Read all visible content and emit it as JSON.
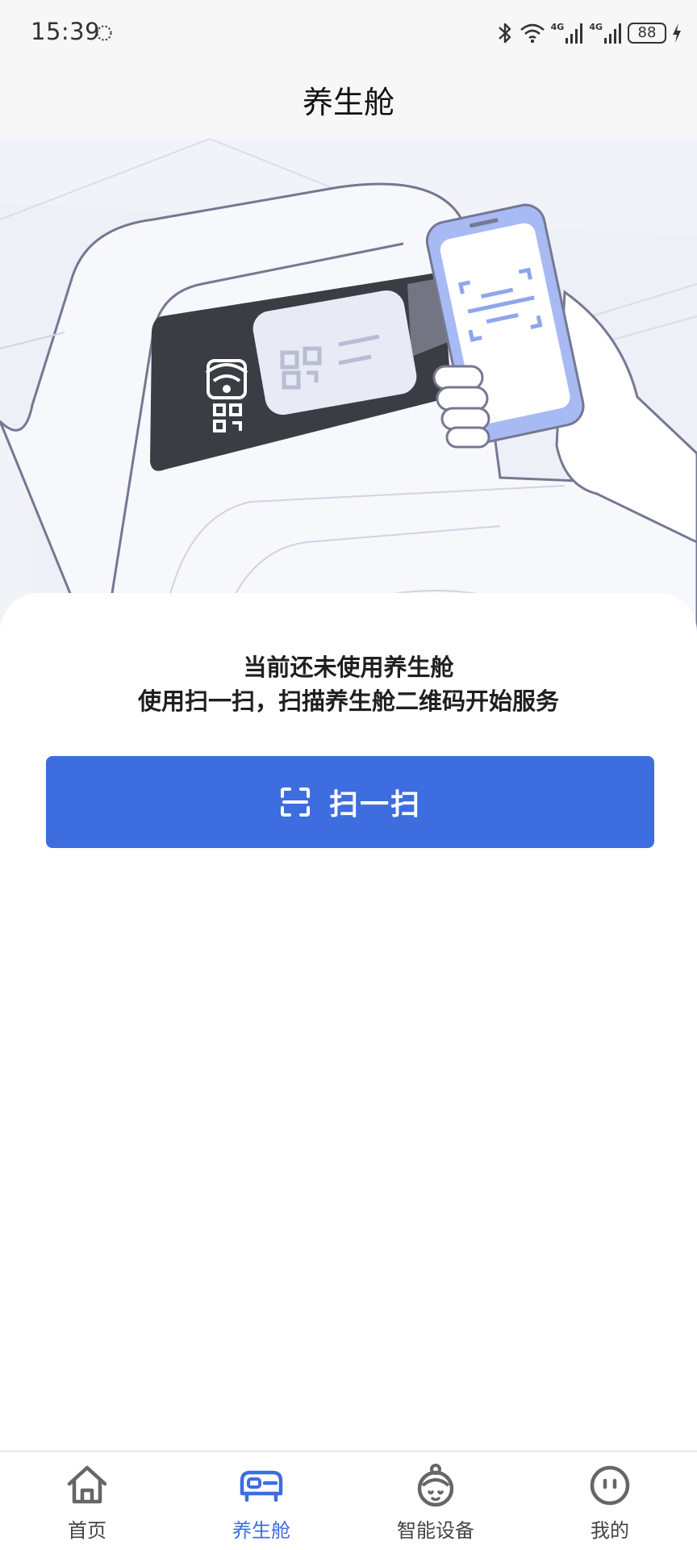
{
  "status_bar": {
    "time": "15:39",
    "net_type_1": "4G",
    "net_type_2": "4G",
    "battery": "88",
    "icons": [
      "loading-icon",
      "bluetooth-icon",
      "wifi-icon",
      "signal-icon",
      "signal-icon",
      "battery-icon",
      "charging-icon"
    ]
  },
  "nav": {
    "title": "养生舱"
  },
  "hero": {
    "icon": "scan-qr-illustration"
  },
  "message": {
    "line1": "当前还未使用养生舱",
    "line2": "使用扫一扫，扫描养生舱二维码开始服务"
  },
  "scan_button": {
    "label": "扫一扫",
    "icon": "scan-icon"
  },
  "tabs": [
    {
      "label": "首页",
      "icon": "home-icon",
      "active": false
    },
    {
      "label": "养生舱",
      "icon": "capsule-icon",
      "active": true
    },
    {
      "label": "智能设备",
      "icon": "smart-device-icon",
      "active": false
    },
    {
      "label": "我的",
      "icon": "profile-icon",
      "active": false
    }
  ],
  "colors": {
    "accent": "#3e6de0",
    "tab_inactive": "#444444",
    "panel_dark": "#3b3d45"
  }
}
